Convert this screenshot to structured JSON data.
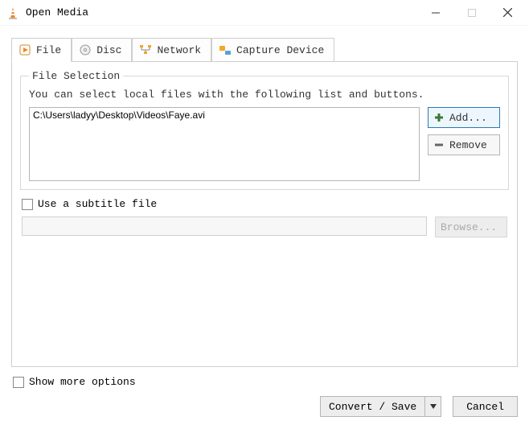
{
  "window": {
    "title": "Open Media"
  },
  "tabs": {
    "file": "File",
    "disc": "Disc",
    "network": "Network",
    "capture": "Capture Device"
  },
  "fileSelection": {
    "legend": "File Selection",
    "hint": "You can select local files with the following list and buttons.",
    "files": [
      "C:\\Users\\ladyy\\Desktop\\Videos\\Faye.avi"
    ],
    "addLabel": "Add...",
    "removeLabel": "Remove"
  },
  "subtitle": {
    "checkboxLabel": "Use a subtitle file",
    "browseLabel": "Browse..."
  },
  "footer": {
    "showMore": "Show more options",
    "convert": "Convert / Save",
    "cancel": "Cancel"
  }
}
